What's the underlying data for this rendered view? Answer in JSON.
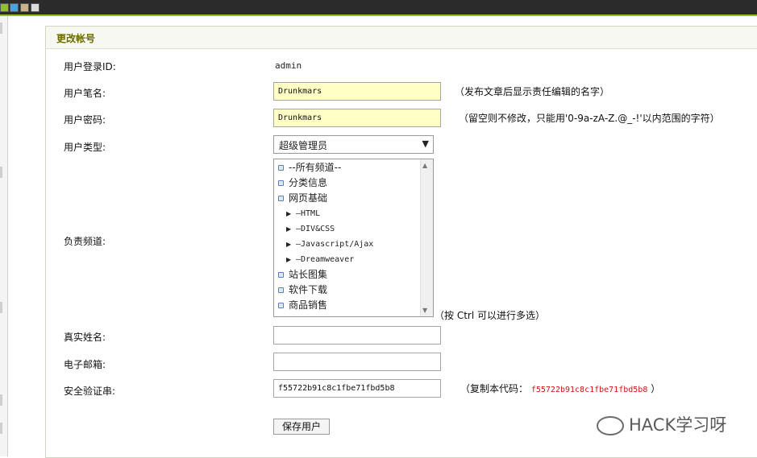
{
  "colors": {
    "accent": "#8fbf2a",
    "title": "#6b6b00",
    "field_highlight": "#ffffc6",
    "code": "#d01515"
  },
  "panel": {
    "title": "更改帐号"
  },
  "form": {
    "login_id": {
      "label": "用户登录ID:",
      "value": "admin"
    },
    "pen_name": {
      "label": "用户笔名:",
      "value": "Drunkmars",
      "hint": "（发布文章后显示责任编辑的名字）"
    },
    "password": {
      "label": "用户密码:",
      "value": "Drunkmars",
      "hint": "（留空则不修改，只能用'0-9a-zA-Z.@_-!'以内范围的字符）"
    },
    "user_type": {
      "label": "用户类型:",
      "selected": "超级管理员"
    },
    "channels": {
      "label": "负责频道:",
      "hint": "（按 Ctrl 可以进行多选）",
      "options": [
        {
          "text": "--所有频道--",
          "level": 0
        },
        {
          "text": "分类信息",
          "level": 0
        },
        {
          "text": "网页基础",
          "level": 0
        },
        {
          "text": "—HTML",
          "level": 1
        },
        {
          "text": "—DIV&CSS",
          "level": 1
        },
        {
          "text": "—Javascript/Ajax",
          "level": 1
        },
        {
          "text": "—Dreamweaver",
          "level": 1
        },
        {
          "text": "站长图集",
          "level": 0
        },
        {
          "text": "软件下载",
          "level": 0
        },
        {
          "text": "商品销售",
          "level": 0
        }
      ]
    },
    "real_name": {
      "label": "真实姓名:",
      "value": ""
    },
    "email": {
      "label": "电子邮箱:",
      "value": ""
    },
    "safe_code": {
      "label": "安全验证串:",
      "value": "f55722b91c8c1fbe71fbd5b8",
      "hint_prefix": "（复制本代码：",
      "hint_code": "f55722b91c8c1fbe71fbd5b8",
      "hint_suffix": "）"
    },
    "save_label": "保存用户"
  },
  "watermark": {
    "text": "HACK学习呀",
    "icon": "wechat-icon"
  }
}
